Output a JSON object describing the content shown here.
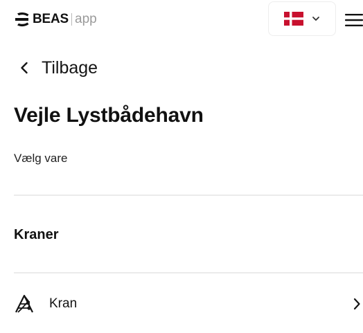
{
  "header": {
    "logo_brand": "BEAS",
    "logo_suffix": "app",
    "language": {
      "flag": "flag-denmark",
      "flag_colors": {
        "red": "#c8102e",
        "white": "#ffffff"
      }
    }
  },
  "nav": {
    "back_label": "Tilbage"
  },
  "page": {
    "title": "Vejle Lystbådehavn",
    "subtitle": "Vælg vare"
  },
  "sections": [
    {
      "title": "Kraner",
      "items": [
        {
          "label": "Kran",
          "icon": "crane-icon"
        }
      ]
    }
  ]
}
